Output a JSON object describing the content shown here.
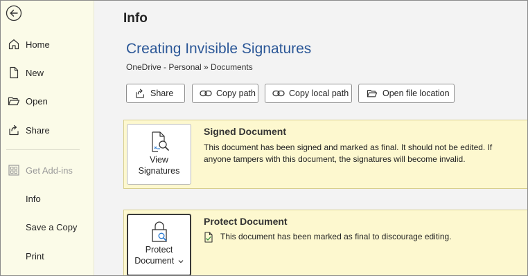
{
  "sidebar": {
    "back_icon": "back-arrow-icon",
    "items": [
      {
        "label": "Home",
        "icon": "home-icon"
      },
      {
        "label": "New",
        "icon": "new-document-icon"
      },
      {
        "label": "Open",
        "icon": "open-folder-icon"
      },
      {
        "label": "Share",
        "icon": "share-icon"
      },
      {
        "label": "Get Add-ins",
        "icon": "add-ins-icon",
        "disabled": true
      },
      {
        "label": "Info",
        "active": true
      },
      {
        "label": "Save a Copy"
      },
      {
        "label": "Print"
      }
    ]
  },
  "main": {
    "page_title": "Info",
    "doc_title": "Creating Invisible Signatures",
    "doc_path": "OneDrive - Personal » Documents",
    "actions": [
      {
        "label": "Share",
        "icon": "share-icon"
      },
      {
        "label": "Copy path",
        "icon": "link-icon"
      },
      {
        "label": "Copy local path",
        "icon": "link-icon"
      },
      {
        "label": "Open file location",
        "icon": "folder-icon"
      }
    ],
    "signed": {
      "button_line1": "View",
      "button_line2": "Signatures",
      "title": "Signed Document",
      "text": "This document has been signed and marked as final. It should not be edited.  If anyone tampers with this document, the signatures will become invalid."
    },
    "protect": {
      "button_line1": "Protect",
      "button_line2": "Document",
      "title": "Protect Document",
      "text": "This document has been marked as final to discourage editing."
    }
  },
  "colors": {
    "sidebar_bg": "#fbfbe8",
    "card_bg": "#fdf8cf",
    "title_blue": "#2b5797"
  }
}
